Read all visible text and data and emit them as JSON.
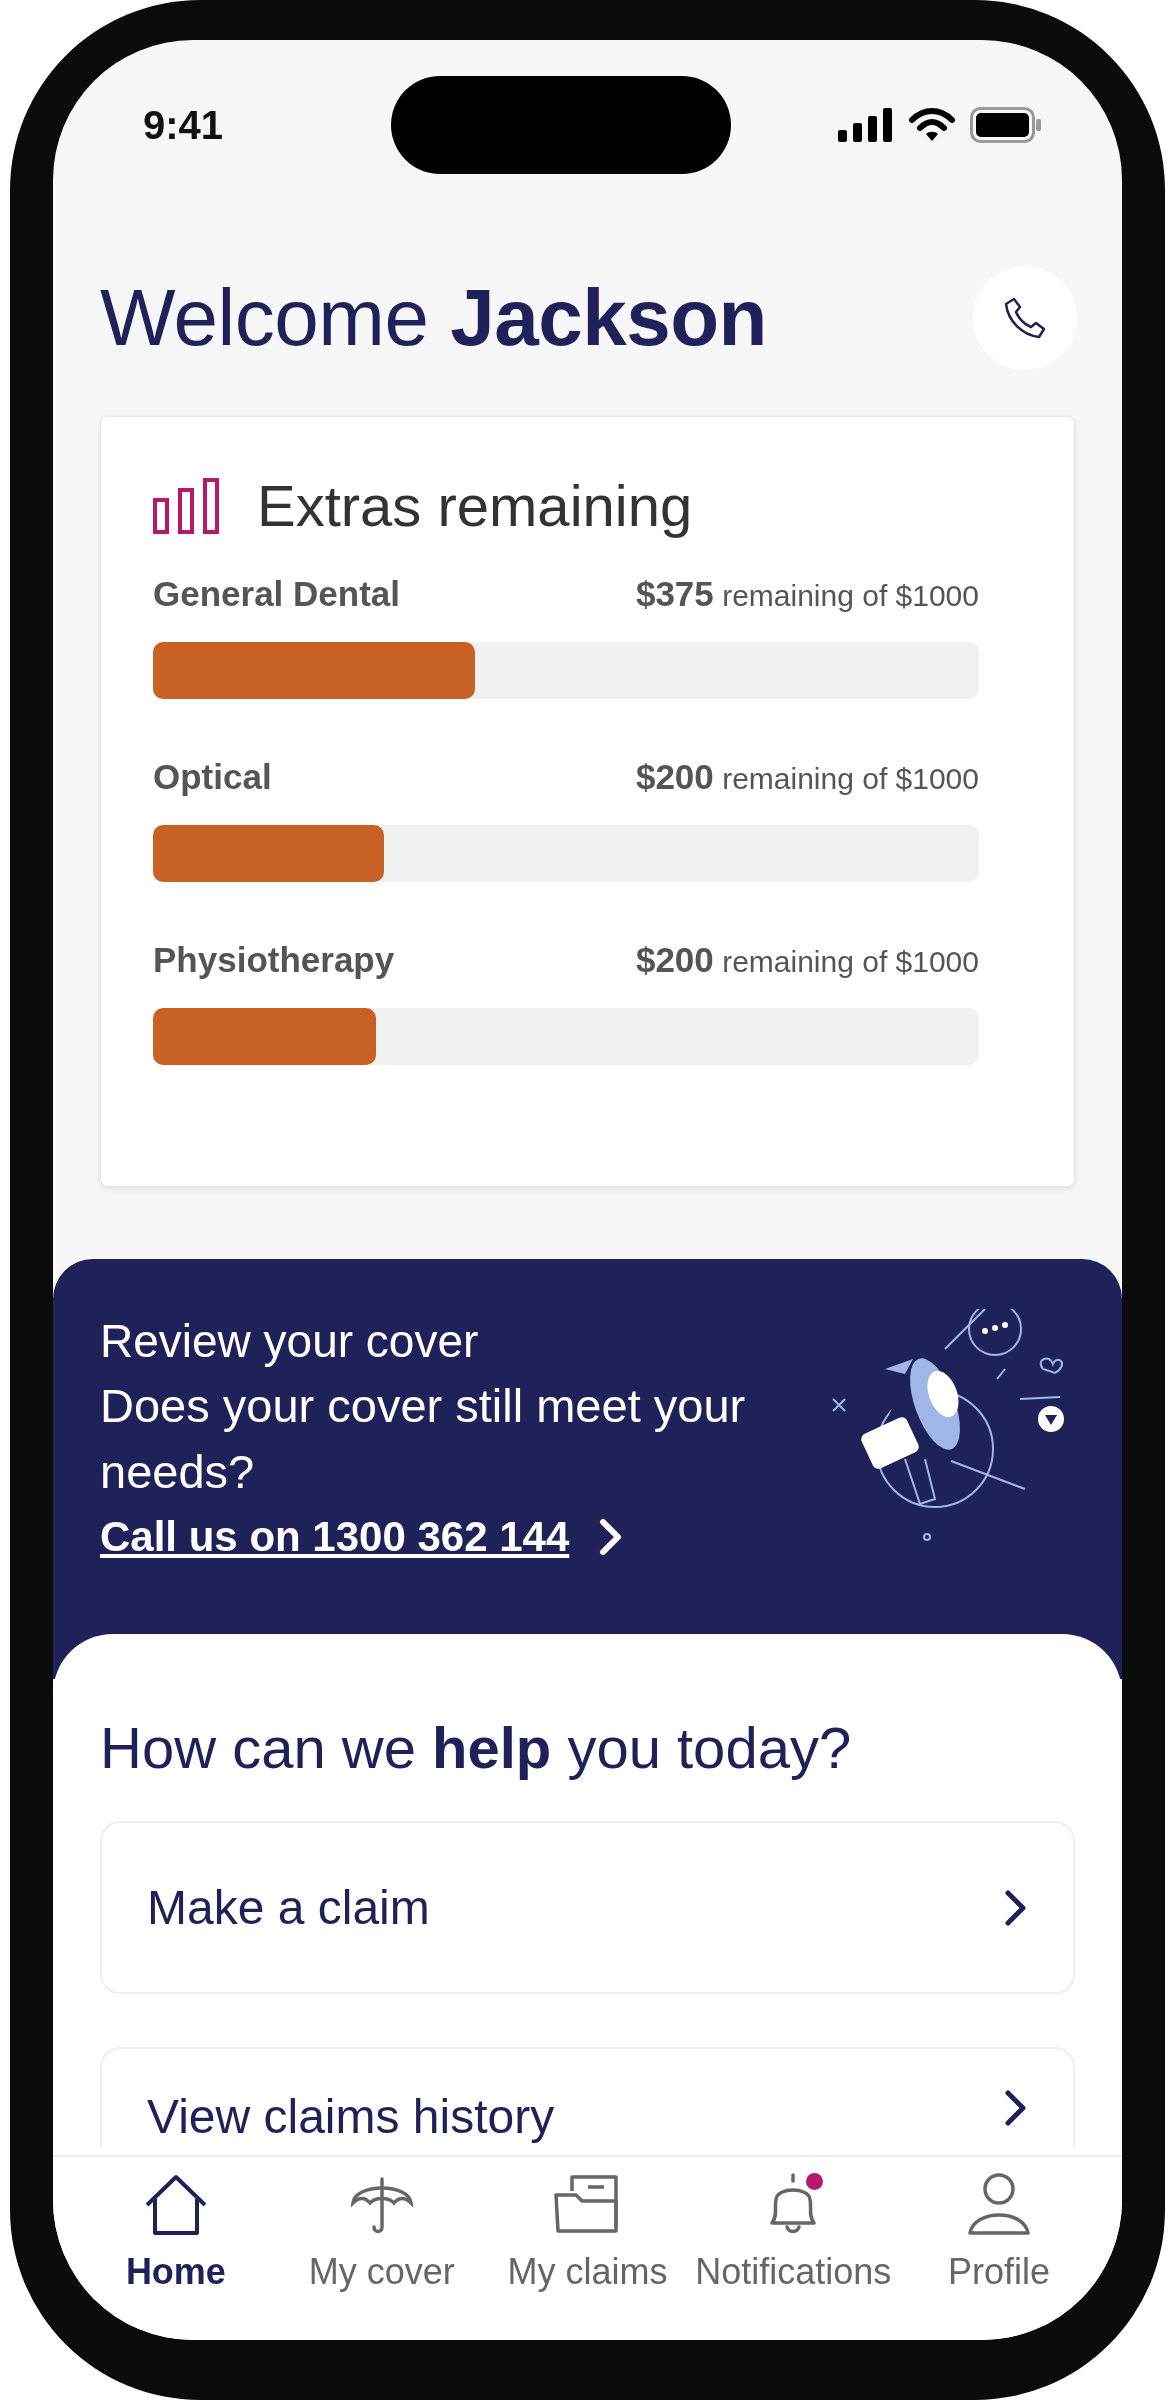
{
  "status_bar": {
    "time": "9:41"
  },
  "header": {
    "greeting": "Welcome **Jackson**"
  },
  "extras": {
    "title": "Extras remaining",
    "items": [
      {
        "name": "General Dental",
        "amount": "**$375** remaining of $1000",
        "level": 0.39
      },
      {
        "name": "Optical",
        "amount": "**$200** remaining of $1000",
        "level": 0.28
      },
      {
        "name": "Physiotherapy",
        "amount": "**$200** remaining of $1000",
        "level": 0.27
      }
    ]
  },
  "banner": {
    "title": "Review your cover",
    "text": "Does your cover still meet your needs?",
    "link": "Call us on 1300 362 144"
  },
  "help": {
    "heading": "How can we **help** you today?",
    "actions": [
      "Make a claim",
      "View claims history"
    ]
  },
  "tabs": [
    {
      "label": "Home",
      "kind": "home",
      "selected": true,
      "badge": false
    },
    {
      "label": "My cover",
      "kind": "cover",
      "selected": false,
      "badge": false
    },
    {
      "label": "My claims",
      "kind": "claims",
      "selected": false,
      "badge": false
    },
    {
      "label": "Notifications",
      "kind": "notifications",
      "selected": false,
      "badge": true
    },
    {
      "label": "Profile",
      "kind": "profile",
      "selected": false,
      "badge": false
    }
  ]
}
